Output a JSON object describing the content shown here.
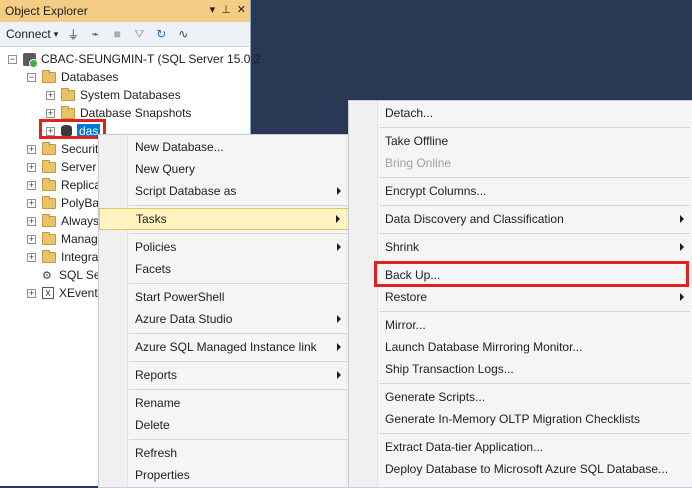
{
  "object_explorer": {
    "title": "Object Explorer",
    "toolbar": {
      "connect_label": "Connect"
    },
    "tree": {
      "server": "CBAC-SEUNGMIN-T (SQL Server 15.0.2",
      "databases": "Databases",
      "system_databases": "System Databases",
      "database_snapshots": "Database Snapshots",
      "selected_db": "das",
      "security": "Securit",
      "server_objects": "Server",
      "replication": "Replica",
      "polybase": "PolyBa",
      "always_on": "Always",
      "management": "Manag",
      "integration": "Integra",
      "sql_agent": "SQL Se",
      "xevent": "XEvent"
    }
  },
  "context_menu": {
    "items": [
      "New Database...",
      "New Query",
      "Script Database as",
      "Tasks",
      "Policies",
      "Facets",
      "Start PowerShell",
      "Azure Data Studio",
      "Azure SQL Managed Instance link",
      "Reports",
      "Rename",
      "Delete",
      "Refresh",
      "Properties"
    ]
  },
  "tasks_submenu": {
    "items": [
      "Detach...",
      "Take Offline",
      "Bring Online",
      "Encrypt Columns...",
      "Data Discovery and Classification",
      "Shrink",
      "Back Up...",
      "Restore",
      "Mirror...",
      "Launch Database Mirroring Monitor...",
      "Ship Transaction Logs...",
      "Generate Scripts...",
      "Generate In-Memory OLTP Migration Checklists",
      "Extract Data-tier Application...",
      "Deploy Database to Microsoft Azure SQL Database..."
    ]
  },
  "colors": {
    "title_bar": "#f5cc84",
    "background": "#293955",
    "highlight": "#fdf4bf",
    "annotation_red": "#e0211d",
    "selection_blue": "#0078d7"
  }
}
